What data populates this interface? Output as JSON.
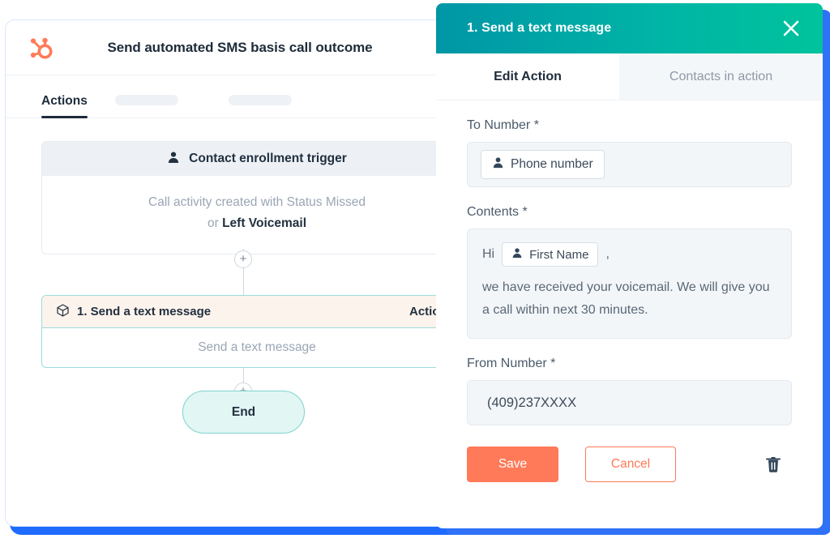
{
  "workflow_window": {
    "logo": "hubspot-sprocket-logo",
    "title": "Send automated SMS basis call outcome",
    "tabs": [
      {
        "label": "Actions",
        "active": true
      },
      {
        "label": "",
        "active": false
      },
      {
        "label": "",
        "active": false
      }
    ],
    "trigger_card": {
      "icon": "contact-person-icon",
      "header": "Contact enrollment trigger",
      "body_line1": "Call activity created with Status Missed",
      "body_line2_prefix": "or ",
      "body_line2_bold": "Left Voicemail"
    },
    "add_step_icon": "plus-icon",
    "action_card": {
      "icon": "cube-icon",
      "title": "1.  Send a text message",
      "actions_label": "Actions",
      "body": "Send a text message"
    },
    "end_node": {
      "label": "End"
    }
  },
  "edit_panel": {
    "header": {
      "title": "1.  Send a text message",
      "close_icon": "close-icon",
      "gradient_from": "#0096a6",
      "gradient_to": "#00c39c"
    },
    "tabs": [
      {
        "label": "Edit Action",
        "active": true
      },
      {
        "label": "Contacts in action",
        "active": false
      }
    ],
    "to_number": {
      "label": "To Number *",
      "token_icon": "contact-person-icon",
      "token_label": "Phone number"
    },
    "contents": {
      "label": "Contents *",
      "greeting": "Hi",
      "token_icon": "contact-person-icon",
      "token_label": "First Name",
      "comma": ",",
      "body": "we have received your voicemail. We will give you a call within next 30 minutes."
    },
    "from_number": {
      "label": "From Number *",
      "value": "(409)237XXXX"
    },
    "save_label": "Save",
    "cancel_label": "Cancel",
    "delete_icon": "trash-icon"
  },
  "colors": {
    "hubspot_orange": "#ff7a59",
    "panel_shadow_blue": "#2f72f7",
    "teal_accent": "#00b3a6",
    "card_border_teal": "#9cdcdc",
    "end_node_fill": "#e2f6f4"
  }
}
